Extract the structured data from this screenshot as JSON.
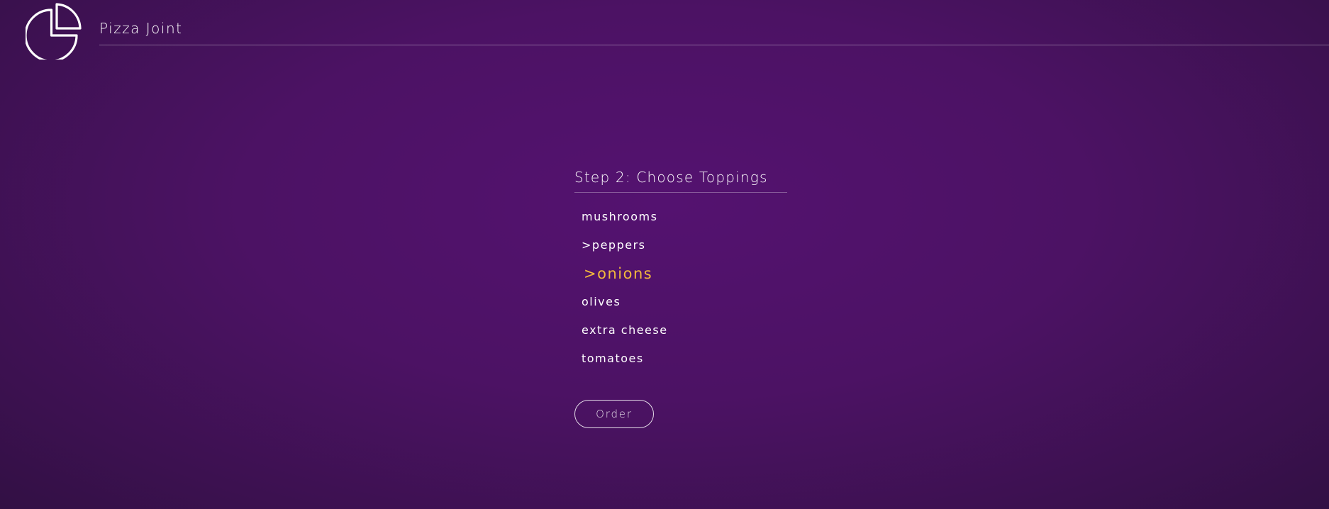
{
  "header": {
    "logo_icon": "pizza-slice-icon",
    "title": "Pizza Joint"
  },
  "step": {
    "title": "Step 2: Choose Toppings"
  },
  "toppings": [
    {
      "label": "mushrooms",
      "selected": false,
      "marker": ""
    },
    {
      "label": "peppers",
      "selected": true,
      "marker": "> "
    },
    {
      "label": "onions",
      "selected": true,
      "marker": "> "
    },
    {
      "label": "olives",
      "selected": false,
      "marker": ""
    },
    {
      "label": "extra cheese",
      "selected": false,
      "marker": ""
    },
    {
      "label": "tomatoes",
      "selected": false,
      "marker": ""
    }
  ],
  "order_button": {
    "label": "Order"
  },
  "colors": {
    "background": "#4c1264",
    "highlight": "#f4b93c",
    "text": "#ffffff"
  }
}
